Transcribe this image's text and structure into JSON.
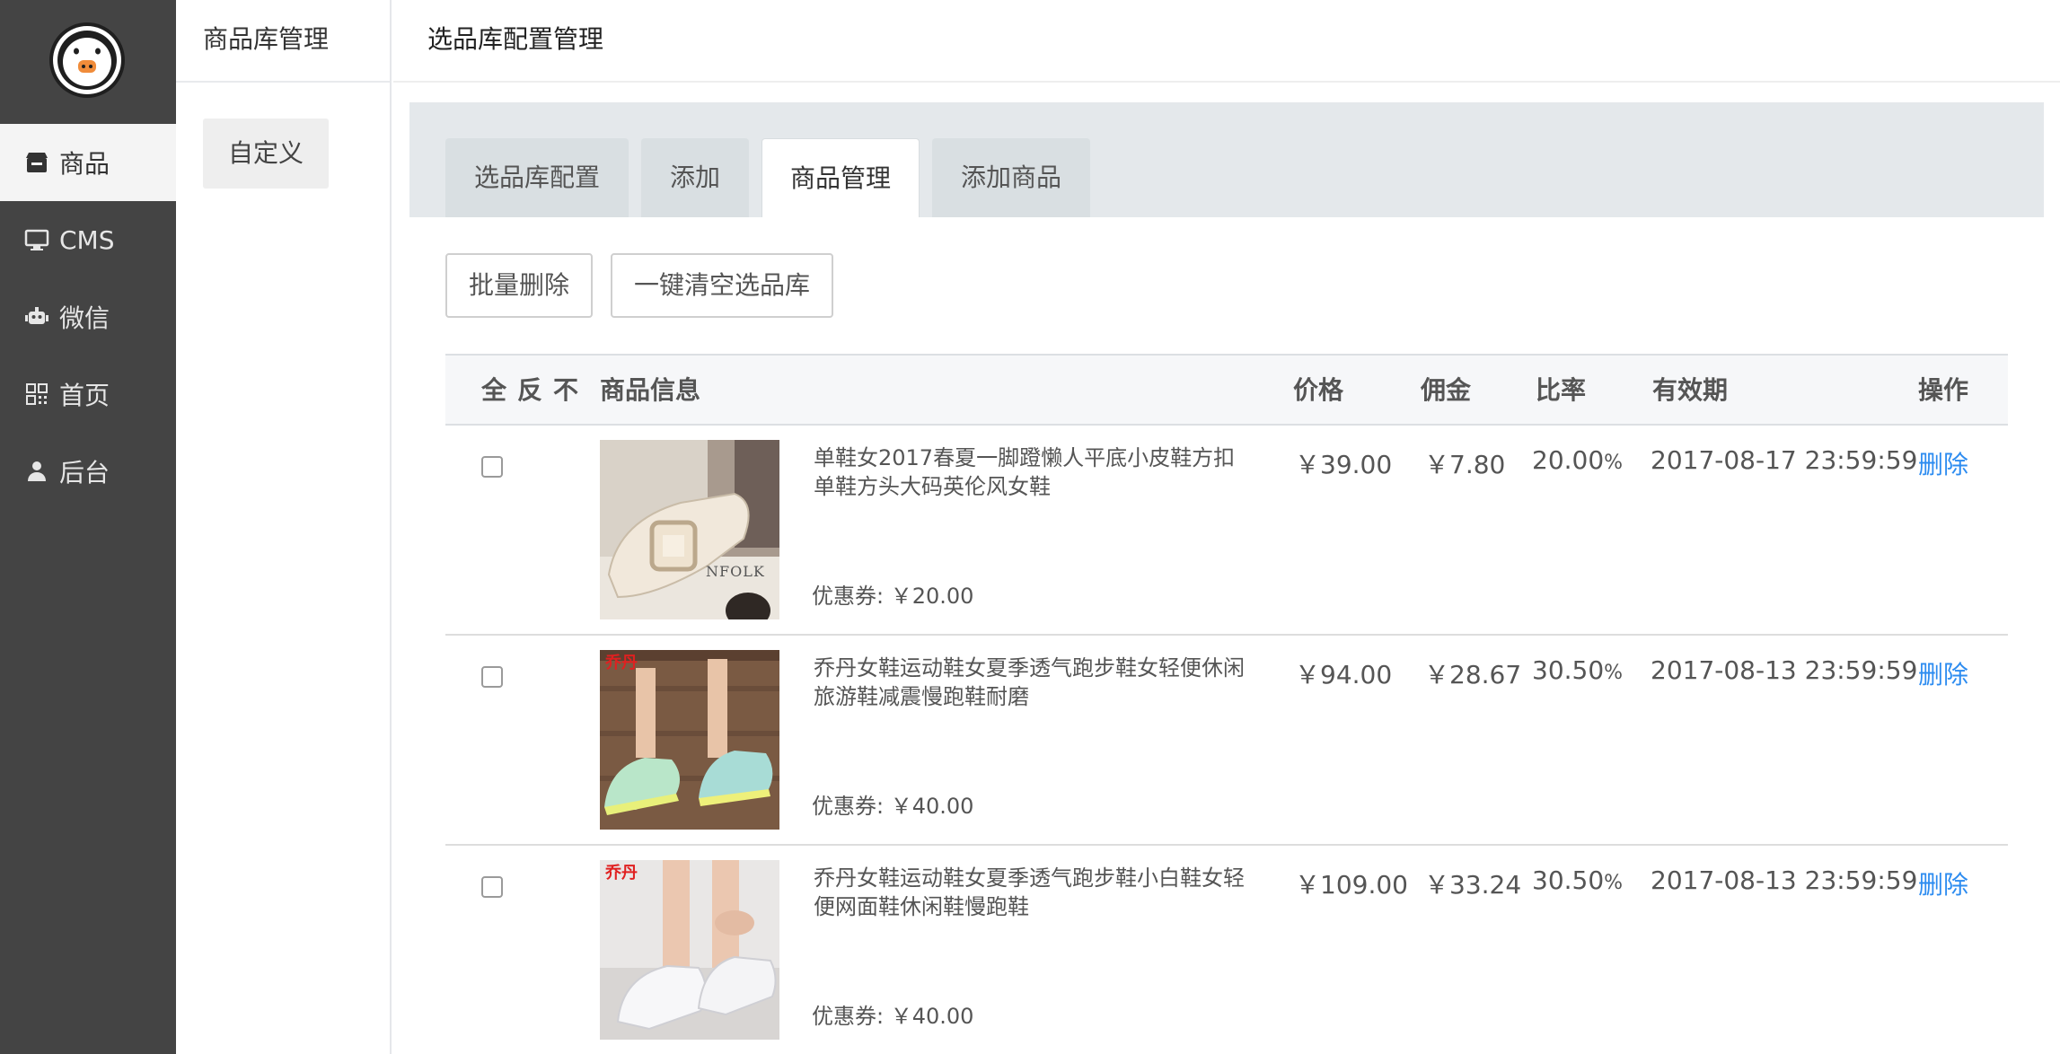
{
  "sidebar": {
    "logo": "pig-face-logo",
    "items": [
      {
        "label": "商品",
        "icon": "store-icon",
        "active": true
      },
      {
        "label": "CMS",
        "icon": "monitor-icon",
        "active": false
      },
      {
        "label": "微信",
        "icon": "robot-icon",
        "active": false
      },
      {
        "label": "首页",
        "icon": "qrcode-icon",
        "active": false
      },
      {
        "label": "后台",
        "icon": "user-icon",
        "active": false
      }
    ]
  },
  "submenu": {
    "title": "商品库管理",
    "items": [
      {
        "label": "自定义"
      }
    ]
  },
  "main": {
    "title": "选品库配置管理",
    "tabs": [
      {
        "label": "选品库配置",
        "active": false
      },
      {
        "label": "添加",
        "active": false
      },
      {
        "label": "商品管理",
        "active": true
      },
      {
        "label": "添加商品",
        "active": false
      }
    ],
    "actions": {
      "batch_delete": "批量删除",
      "clear_all": "一键清空选品库"
    }
  },
  "table": {
    "select_links": [
      "全",
      "反",
      "不"
    ],
    "headers": {
      "info": "商品信息",
      "price": "价格",
      "commission": "佣金",
      "rate": "比率",
      "expiry": "有效期",
      "action": "操作"
    },
    "rows": [
      {
        "title": "单鞋女2017春夏一脚蹬懒人平底小皮鞋方扣单鞋方头大码英伦风女鞋",
        "coupon": "优惠券: ￥20.00",
        "price": "￥39.00",
        "commission": "￥7.80",
        "rate": "20.00",
        "rate_unit": "%",
        "expiry": "2017-08-17 23:59:59",
        "action": "删除",
        "image_text": "NFOLK"
      },
      {
        "title": "乔丹女鞋运动鞋女夏季透气跑步鞋女轻便休闲旅游鞋减震慢跑鞋耐磨",
        "coupon": "优惠券: ￥40.00",
        "price": "￥94.00",
        "commission": "￥28.67",
        "rate": "30.50",
        "rate_unit": "%",
        "expiry": "2017-08-13 23:59:59",
        "action": "删除",
        "image_text": "乔丹"
      },
      {
        "title": "乔丹女鞋运动鞋女夏季透气跑步鞋小白鞋女轻便网面鞋休闲鞋慢跑鞋",
        "coupon": "优惠券: ￥40.00",
        "price": "￥109.00",
        "commission": "￥33.24",
        "rate": "30.50",
        "rate_unit": "%",
        "expiry": "2017-08-13 23:59:59",
        "action": "删除",
        "image_text": "乔丹"
      }
    ]
  },
  "colors": {
    "sidebar_bg": "#444444",
    "link": "#2d8cf0",
    "tabs_bg": "#e4e8eb"
  }
}
